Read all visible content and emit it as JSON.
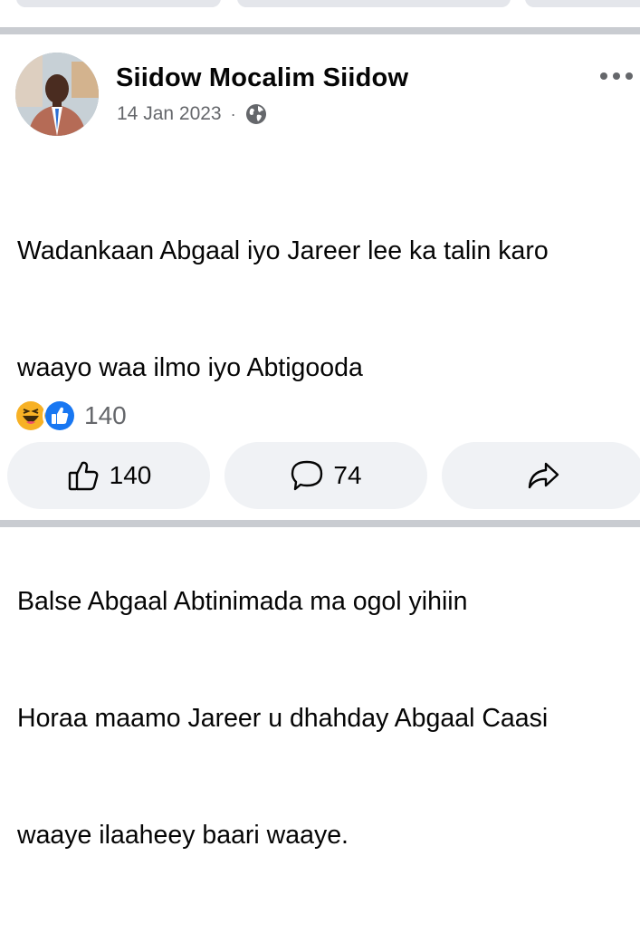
{
  "post": {
    "author": "Siidow Mocalim Siidow",
    "date": "14 Jan 2023",
    "separator": "·",
    "body_line_1": "Wadankaan Abgaal iyo Jareer lee ka talin karo",
    "body_line_2": "waayo waa ilmo iyo Abtigooda",
    "body_line_3": "Balse Abgaal Abtinimada ma ogol yihiin",
    "body_line_4": "Horaa maamo Jareer u dhahday Abgaal Caasi",
    "body_line_5": "waaye ilaaheey baari waaye.",
    "reaction_count": "140"
  },
  "actions": {
    "like_count": "140",
    "comment_count": "74"
  },
  "icons": {
    "privacy": "globe-icon",
    "more": "more-options-icon",
    "haha": "haha-reaction-icon",
    "like_reaction": "like-reaction-icon",
    "like": "thumbs-up-icon",
    "comment": "comment-icon",
    "share": "share-icon"
  },
  "colors": {
    "divider": "#c9ccd1",
    "button_bg": "#f0f2f5",
    "secondary_text": "#65676b",
    "like_blue": "#1877f2",
    "haha_yellow": "#f7b125"
  }
}
